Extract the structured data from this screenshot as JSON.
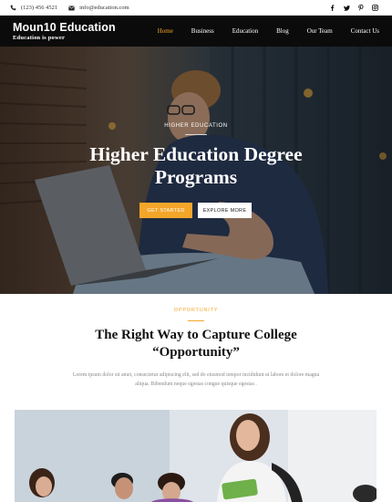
{
  "topbar": {
    "phone": "(123) 456 4521",
    "email": "info@education.com",
    "socials": [
      "facebook-icon",
      "twitter-icon",
      "pinterest-icon",
      "instagram-icon"
    ]
  },
  "brand": {
    "name": "Moun10 Education",
    "tagline": "Education is power"
  },
  "nav": {
    "items": [
      "Home",
      "Business",
      "Education",
      "Blog",
      "Our Team",
      "Contact Us"
    ],
    "active": "Home"
  },
  "hero": {
    "kicker": "HIGHER EDUCATION",
    "title_line1": "Higher Education Degree",
    "title_line2": "Programs",
    "primary_button": "GET STARTED",
    "secondary_button": "EXPLORE MORE"
  },
  "opportunity": {
    "kicker": "OPPORTUNITY",
    "title_line1": "The Right Way to Capture College",
    "title_line2": "“Opportunity”",
    "desc_line1": "Lorem ipsum dolor sit amet, consectetur adipiscing elit, sed do eiusmod tempor incididunt ut labore et dolore magna",
    "desc_line2": "aliqua. Bibendum neque egestas congue quisque egestas ."
  },
  "colors": {
    "accent": "#f4a62a",
    "nav_bg": "#0b0b0b"
  }
}
